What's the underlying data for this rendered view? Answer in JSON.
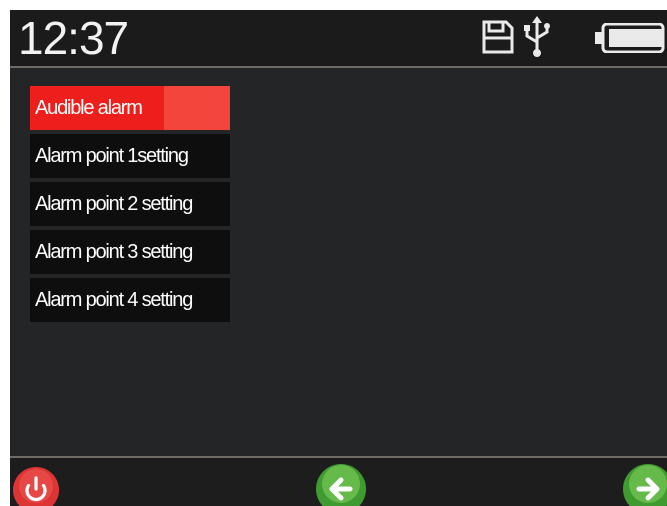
{
  "status_bar": {
    "time": "12:37",
    "icons": [
      "save-icon",
      "usb-icon",
      "battery-icon"
    ]
  },
  "menu": {
    "items": [
      {
        "label": "Audible alarm",
        "selected": true
      },
      {
        "label": "Alarm point 1setting",
        "selected": false
      },
      {
        "label": "Alarm point 2 setting",
        "selected": false
      },
      {
        "label": "Alarm point 3 setting",
        "selected": false
      },
      {
        "label": "Alarm point 4 setting",
        "selected": false
      }
    ]
  },
  "bottom_bar": {
    "buttons": [
      "power-icon",
      "back-arrow-icon",
      "forward-arrow-icon"
    ]
  },
  "colors": {
    "selected": "#ed1f1d",
    "background": "#242526",
    "power_button": "#e03b3b",
    "nav_button": "#4fae3a"
  }
}
